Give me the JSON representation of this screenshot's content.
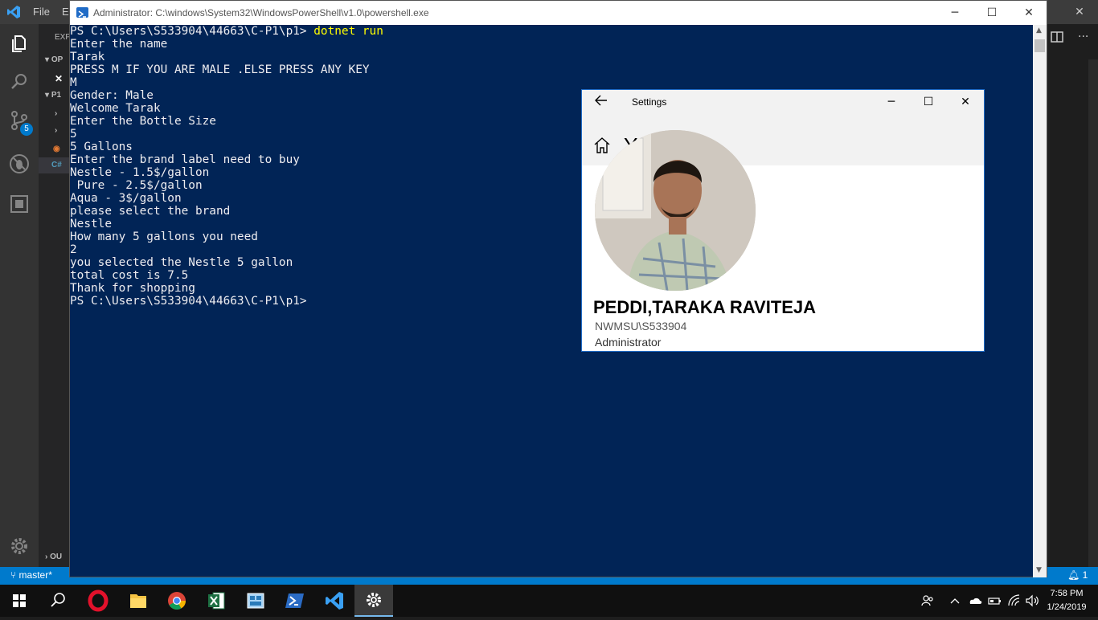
{
  "vscode": {
    "menu": [
      "File",
      "E"
    ],
    "sidebar": {
      "explorer_label": "EXP",
      "open_editors_label": "OP",
      "project_label": "P1",
      "outline_label": "OU"
    },
    "source_control_badge": "5",
    "status": {
      "branch": "master*"
    }
  },
  "powershell": {
    "window_title": "Administrator: C:\\windows\\System32\\WindowsPowerShell\\v1.0\\powershell.exe",
    "prompt": "PS C:\\Users\\S533904\\44663\\C-P1\\p1>",
    "command": "dotnet run",
    "output_lines": [
      "Enter the name",
      "Tarak",
      "PRESS M IF YOU ARE MALE .ELSE PRESS ANY KEY",
      "M",
      "Gender: Male",
      "Welcome Tarak",
      "Enter the Bottle Size",
      "5",
      "5 Gallons",
      "Enter the brand label need to buy",
      "Nestle - 1.5$/gallon",
      " Pure - 2.5$/gallon",
      "Aqua - 3$/gallon",
      "please select the brand",
      "Nestle",
      "How many 5 gallons you need",
      "2",
      "you selected the Nestle 5 gallon",
      "total cost is 7.5",
      "Thank for shopping"
    ],
    "final_prompt": "PS C:\\Users\\S533904\\44663\\C-P1\\p1>"
  },
  "settings": {
    "title": "Settings",
    "page_title": "Your info",
    "user_name": "PEDDI,TARAKA RAVITEJA",
    "account": "NWMSU\\S533904",
    "role": "Administrator"
  },
  "taskbar": {
    "apps": [
      "start-icon",
      "search-icon",
      "opera-icon",
      "file-explorer-icon",
      "chrome-icon",
      "excel-icon",
      "app-icon",
      "powershell-icon",
      "vscode-icon",
      "settings-icon"
    ],
    "time": "7:58 PM",
    "date": "1/24/2019"
  },
  "notifications_badge": "1",
  "colors": {
    "powershell_bg": "#012456",
    "vscode_accent": "#007acc",
    "taskbar_bg": "#101010"
  }
}
